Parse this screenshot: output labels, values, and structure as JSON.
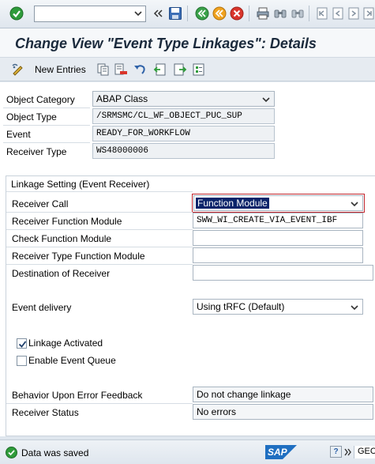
{
  "toolbar": {
    "command_value": "",
    "icons": [
      "enter-icon",
      "back-nav-icon",
      "save-icon",
      "back-icon",
      "exit-icon",
      "cancel-icon",
      "print-icon",
      "find-icon",
      "find-next-icon",
      "first-page-icon",
      "prev-page-icon",
      "next-page-icon",
      "last-page-icon"
    ]
  },
  "title": "Change View \"Event Type Linkages\": Details",
  "app_toolbar": {
    "new_entries_label": "New Entries",
    "icons": [
      "display-change-icon",
      "copy-icon",
      "delete-icon",
      "undo-icon",
      "previous-entry-icon",
      "next-entry-icon",
      "select-all-icon"
    ]
  },
  "header_fields": [
    {
      "label": "Object Category",
      "value": "ABAP Class"
    },
    {
      "label": "Object Type",
      "value": "/SRMSMC/CL_WF_OBJECT_PUC_SUP"
    },
    {
      "label": "Event",
      "value": "READY_FOR_WORKFLOW"
    },
    {
      "label": "Receiver Type",
      "value": "WS48000006"
    }
  ],
  "linkage": {
    "group_title": "Linkage Setting (Event Receiver)",
    "receiver_call": {
      "label": "Receiver Call",
      "value": "Function Module"
    },
    "receiver_function_module": {
      "label": "Receiver Function Module",
      "value": "SWW_WI_CREATE_VIA_EVENT_IBF"
    },
    "check_function_module": {
      "label": "Check Function Module",
      "value": ""
    },
    "receiver_type_function_module": {
      "label": "Receiver Type Function Module",
      "value": ""
    },
    "destination_of_receiver": {
      "label": "Destination of Receiver",
      "value": ""
    },
    "event_delivery": {
      "label": "Event delivery",
      "value": "Using tRFC (Default)"
    },
    "linkage_activated": {
      "label": "Linkage Activated",
      "checked": true
    },
    "enable_event_queue": {
      "label": "Enable Event Queue",
      "checked": false
    },
    "behavior_upon_error": {
      "label": "Behavior Upon Error Feedback",
      "value": "Do not change linkage"
    },
    "receiver_status": {
      "label": "Receiver Status",
      "value": "No errors"
    }
  },
  "statusbar": {
    "message": "Data was saved",
    "sap_logo_text": "SAP",
    "system_text": "GEC"
  }
}
